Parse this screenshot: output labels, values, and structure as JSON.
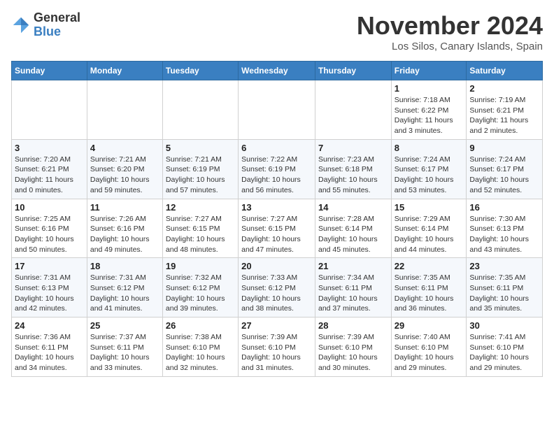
{
  "header": {
    "logo_general": "General",
    "logo_blue": "Blue",
    "month_title": "November 2024",
    "location": "Los Silos, Canary Islands, Spain"
  },
  "weekdays": [
    "Sunday",
    "Monday",
    "Tuesday",
    "Wednesday",
    "Thursday",
    "Friday",
    "Saturday"
  ],
  "weeks": [
    [
      {
        "day": "",
        "info": ""
      },
      {
        "day": "",
        "info": ""
      },
      {
        "day": "",
        "info": ""
      },
      {
        "day": "",
        "info": ""
      },
      {
        "day": "",
        "info": ""
      },
      {
        "day": "1",
        "info": "Sunrise: 7:18 AM\nSunset: 6:22 PM\nDaylight: 11 hours and 3 minutes."
      },
      {
        "day": "2",
        "info": "Sunrise: 7:19 AM\nSunset: 6:21 PM\nDaylight: 11 hours and 2 minutes."
      }
    ],
    [
      {
        "day": "3",
        "info": "Sunrise: 7:20 AM\nSunset: 6:21 PM\nDaylight: 11 hours and 0 minutes."
      },
      {
        "day": "4",
        "info": "Sunrise: 7:21 AM\nSunset: 6:20 PM\nDaylight: 10 hours and 59 minutes."
      },
      {
        "day": "5",
        "info": "Sunrise: 7:21 AM\nSunset: 6:19 PM\nDaylight: 10 hours and 57 minutes."
      },
      {
        "day": "6",
        "info": "Sunrise: 7:22 AM\nSunset: 6:19 PM\nDaylight: 10 hours and 56 minutes."
      },
      {
        "day": "7",
        "info": "Sunrise: 7:23 AM\nSunset: 6:18 PM\nDaylight: 10 hours and 55 minutes."
      },
      {
        "day": "8",
        "info": "Sunrise: 7:24 AM\nSunset: 6:17 PM\nDaylight: 10 hours and 53 minutes."
      },
      {
        "day": "9",
        "info": "Sunrise: 7:24 AM\nSunset: 6:17 PM\nDaylight: 10 hours and 52 minutes."
      }
    ],
    [
      {
        "day": "10",
        "info": "Sunrise: 7:25 AM\nSunset: 6:16 PM\nDaylight: 10 hours and 50 minutes."
      },
      {
        "day": "11",
        "info": "Sunrise: 7:26 AM\nSunset: 6:16 PM\nDaylight: 10 hours and 49 minutes."
      },
      {
        "day": "12",
        "info": "Sunrise: 7:27 AM\nSunset: 6:15 PM\nDaylight: 10 hours and 48 minutes."
      },
      {
        "day": "13",
        "info": "Sunrise: 7:27 AM\nSunset: 6:15 PM\nDaylight: 10 hours and 47 minutes."
      },
      {
        "day": "14",
        "info": "Sunrise: 7:28 AM\nSunset: 6:14 PM\nDaylight: 10 hours and 45 minutes."
      },
      {
        "day": "15",
        "info": "Sunrise: 7:29 AM\nSunset: 6:14 PM\nDaylight: 10 hours and 44 minutes."
      },
      {
        "day": "16",
        "info": "Sunrise: 7:30 AM\nSunset: 6:13 PM\nDaylight: 10 hours and 43 minutes."
      }
    ],
    [
      {
        "day": "17",
        "info": "Sunrise: 7:31 AM\nSunset: 6:13 PM\nDaylight: 10 hours and 42 minutes."
      },
      {
        "day": "18",
        "info": "Sunrise: 7:31 AM\nSunset: 6:12 PM\nDaylight: 10 hours and 41 minutes."
      },
      {
        "day": "19",
        "info": "Sunrise: 7:32 AM\nSunset: 6:12 PM\nDaylight: 10 hours and 39 minutes."
      },
      {
        "day": "20",
        "info": "Sunrise: 7:33 AM\nSunset: 6:12 PM\nDaylight: 10 hours and 38 minutes."
      },
      {
        "day": "21",
        "info": "Sunrise: 7:34 AM\nSunset: 6:11 PM\nDaylight: 10 hours and 37 minutes."
      },
      {
        "day": "22",
        "info": "Sunrise: 7:35 AM\nSunset: 6:11 PM\nDaylight: 10 hours and 36 minutes."
      },
      {
        "day": "23",
        "info": "Sunrise: 7:35 AM\nSunset: 6:11 PM\nDaylight: 10 hours and 35 minutes."
      }
    ],
    [
      {
        "day": "24",
        "info": "Sunrise: 7:36 AM\nSunset: 6:11 PM\nDaylight: 10 hours and 34 minutes."
      },
      {
        "day": "25",
        "info": "Sunrise: 7:37 AM\nSunset: 6:11 PM\nDaylight: 10 hours and 33 minutes."
      },
      {
        "day": "26",
        "info": "Sunrise: 7:38 AM\nSunset: 6:10 PM\nDaylight: 10 hours and 32 minutes."
      },
      {
        "day": "27",
        "info": "Sunrise: 7:39 AM\nSunset: 6:10 PM\nDaylight: 10 hours and 31 minutes."
      },
      {
        "day": "28",
        "info": "Sunrise: 7:39 AM\nSunset: 6:10 PM\nDaylight: 10 hours and 30 minutes."
      },
      {
        "day": "29",
        "info": "Sunrise: 7:40 AM\nSunset: 6:10 PM\nDaylight: 10 hours and 29 minutes."
      },
      {
        "day": "30",
        "info": "Sunrise: 7:41 AM\nSunset: 6:10 PM\nDaylight: 10 hours and 29 minutes."
      }
    ]
  ]
}
